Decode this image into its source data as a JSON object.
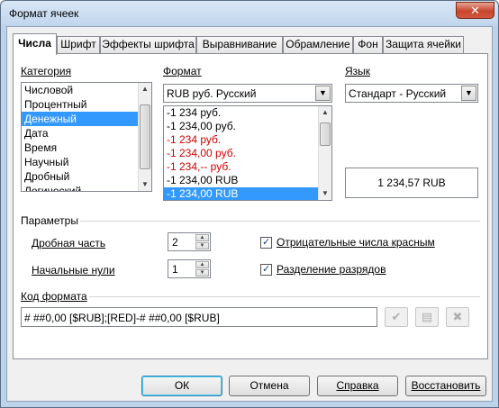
{
  "window": {
    "title": "Формат ячеек",
    "close_glyph": "✕"
  },
  "tabs": [
    {
      "label": "Числа",
      "active": true
    },
    {
      "label": "Шрифт",
      "active": false
    },
    {
      "label": "Эффекты шрифта",
      "active": false
    },
    {
      "label": "Выравнивание",
      "active": false
    },
    {
      "label": "Обрамление",
      "active": false
    },
    {
      "label": "Фон",
      "active": false
    },
    {
      "label": "Защита ячейки",
      "active": false
    }
  ],
  "category": {
    "label": "Категория",
    "items": [
      "Числовой",
      "Процентный",
      "Денежный",
      "Дата",
      "Время",
      "Научный",
      "Дробный",
      "Логический"
    ],
    "selected": "Денежный"
  },
  "format": {
    "label": "Формат",
    "combo_value": "RUB  руб.  Русский",
    "items": [
      {
        "text": "-1 234 руб.",
        "red": false
      },
      {
        "text": "-1 234,00 руб.",
        "red": false
      },
      {
        "text": "-1 234 руб.",
        "red": true
      },
      {
        "text": "-1 234,00 руб.",
        "red": true
      },
      {
        "text": "-1 234,-- руб.",
        "red": true
      },
      {
        "text": "-1 234,00 RUB",
        "red": false
      },
      {
        "text": "-1 234,00 RUB",
        "red": false,
        "selected": true
      }
    ]
  },
  "language": {
    "label": "Язык",
    "value": "Стандарт - Русский"
  },
  "preview": {
    "text": "1 234,57 RUB"
  },
  "options": {
    "label": "Параметры",
    "decimal_label": "Дробная часть",
    "decimal_value": "2",
    "leading_zeros_label": "Начальные нули",
    "leading_zeros_value": "1",
    "negative_red_label": "Отрицательные числа красным",
    "negative_red_checked": true,
    "thousands_sep_label": "Разделение разрядов",
    "thousands_sep_checked": true
  },
  "format_code": {
    "label": "Код формата",
    "value": "# ##0,00 [$RUB];[RED]-# ##0,00 [$RUB]"
  },
  "buttons": {
    "ok": "ОК",
    "cancel": "Отмена",
    "help": "Справка",
    "reset": "Восстановить"
  },
  "icons": {
    "accept": "check-icon",
    "edit_comment": "comment-icon",
    "delete": "delete-icon"
  },
  "colors": {
    "selection": "#3399ff",
    "negative_red": "#d00000",
    "title_bar": "#c0d5ec",
    "close_button": "#c7452c"
  }
}
